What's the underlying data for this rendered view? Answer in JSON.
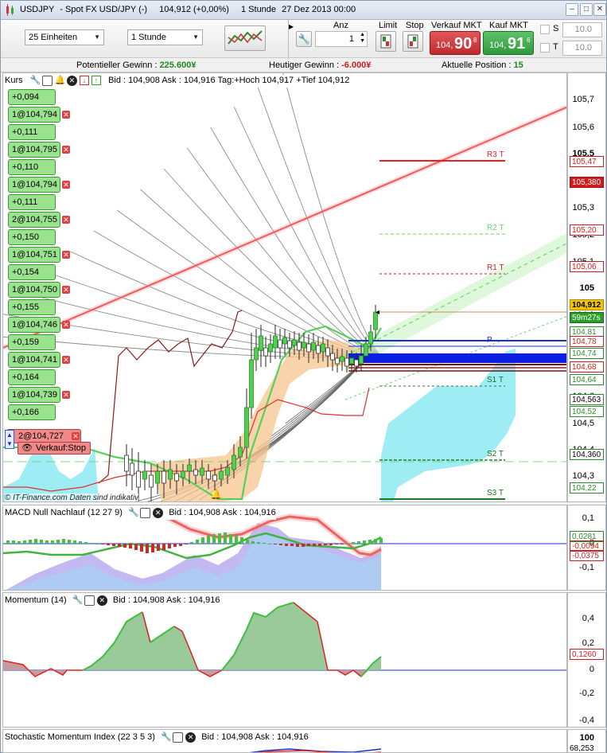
{
  "window": {
    "title_symbol": "USDJPY",
    "title_name": "Spot FX USD/JPY (-)",
    "title_price": "104,912 (+0,00%)",
    "title_interval": "1 Stunde",
    "title_date": "27 Dez 2013 00:00"
  },
  "toolbar": {
    "units_select": "25 Einheiten",
    "interval_select": "1 Stunde",
    "anz_label": "Anz",
    "anz_value": "1",
    "limit_label": "Limit",
    "stop_label": "Stop",
    "sell_label": "Verkauf MKT",
    "buy_label": "Kauf MKT",
    "sell_small": "104,",
    "sell_big": "90",
    "sell_sup": "8",
    "buy_small": "104,",
    "buy_big": "91",
    "buy_sup": "6",
    "s_label": "S",
    "t_label": "T",
    "s_value": "10.0",
    "t_value": "10.0"
  },
  "infobar": {
    "pot_label": "Potentieller Gewinn : ",
    "pot_value": "225.600¥",
    "today_label": "Heutiger Gewinn : ",
    "today_value": "-6.000¥",
    "pos_label": "Aktuelle Position : ",
    "pos_value": "15"
  },
  "main": {
    "title": "Kurs",
    "info": "Bid : 104,908 Ask : 104,916 Tag:+Hoch 104,917 +Tief 104,912",
    "watermark": "© IT-Finance.com  Daten sind indikativ",
    "orders": [
      {
        "q": "+0,094"
      },
      {
        "p": "1@104,794",
        "q": "+0,111"
      },
      {
        "p": "1@104,795",
        "q": "+0,110"
      },
      {
        "p": "1@104,794",
        "q": "+0,111"
      },
      {
        "p": "2@104,755",
        "q": "+0,150"
      },
      {
        "p": "1@104,751",
        "q": "+0,154"
      },
      {
        "p": "1@104,750",
        "q": "+0,155"
      },
      {
        "p": "1@104,746",
        "q": "+0,159"
      },
      {
        "p": "1@104,741",
        "q": "+0,164"
      },
      {
        "p": "1@104,739",
        "q": "+0,166"
      }
    ],
    "stop_order": "2@104,727",
    "stop_label": "Verkauf:Stop",
    "pivots": [
      "R3 T",
      "R2 T",
      "R1 T",
      "P",
      "S1 T",
      "S2 T",
      "S3 T"
    ],
    "axis_labels": [
      "105,7",
      "105,6",
      "105,5",
      "105,4",
      "105,3",
      "105,2",
      "105,1",
      "105",
      "104,9",
      "104,8",
      "104,7",
      "104,6",
      "104,5",
      "104,4",
      "104,3"
    ],
    "tags": [
      "105,47",
      "105,380",
      "105,20",
      "105,06",
      "104,912",
      "59m27s",
      "104,81",
      "104,78",
      "104,74",
      "104,68",
      "104,64",
      "104,563",
      "104,52",
      "104,360",
      "104,22"
    ],
    "colors": {
      "up": "#3fc24a",
      "down": "#8b1a1a",
      "trend": "#e83c3c",
      "cloud": "#7fe3ef"
    }
  },
  "macd": {
    "title": "MACD Null Nachlauf (12 27 9)",
    "info": "Bid : 104,908 Ask : 104,916",
    "axis": [
      "0,1",
      "0",
      "-0,1"
    ],
    "tags": [
      "0,0281",
      "-0,0094",
      "-0,0375"
    ]
  },
  "momentum": {
    "title": "Momentum (14)",
    "info": "Bid : 104,908 Ask : 104,916",
    "axis": [
      "0,4",
      "0,2",
      "0",
      "-0,2",
      "-0,4"
    ],
    "tag": "0,1260"
  },
  "smi": {
    "title": "Stochastic Momentum Index (22 3 5 3)",
    "info": "Bid : 104,908 Ask : 104,916",
    "axis": [
      "100"
    ],
    "tag": "68,253"
  }
}
